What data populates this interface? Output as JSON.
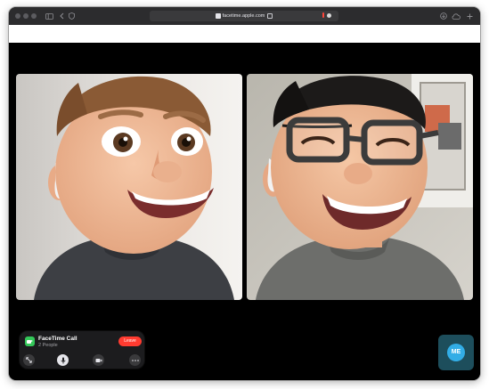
{
  "browser": {
    "url": "facetime.apple.com"
  },
  "call": {
    "app_name": "FaceTime Call",
    "participants": "2 People",
    "leave_label": "Leave"
  },
  "self_view": {
    "initials": "ME"
  },
  "colors": {
    "leave": "#ff3b30",
    "facetime_green": "#34c759",
    "avatar": "#32ade6"
  },
  "icons": [
    "traffic-lights",
    "sidebar-icon",
    "back-icon",
    "forward-icon",
    "shield-icon",
    "lock-icon",
    "download-icon",
    "cloud-icon",
    "new-tab-icon",
    "expand-icon",
    "microphone-icon",
    "camera-icon",
    "more-icon"
  ]
}
